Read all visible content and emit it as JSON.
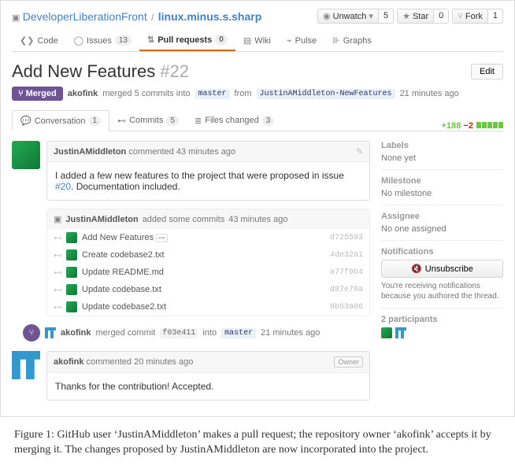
{
  "breadcrumb": {
    "owner": "DeveloperLiberationFront",
    "repo": "linux.minus.s.sharp"
  },
  "repo_actions": {
    "unwatch": "Unwatch",
    "unwatch_count": "5",
    "star": "Star",
    "star_count": "0",
    "fork": "Fork",
    "fork_count": "1"
  },
  "nav": {
    "code": "Code",
    "issues": "Issues",
    "issues_count": "13",
    "pulls": "Pull requests",
    "pulls_count": "0",
    "wiki": "Wiki",
    "pulse": "Pulse",
    "graphs": "Graphs"
  },
  "pr": {
    "title": "Add New Features",
    "number": "#22",
    "edit": "Edit",
    "state": "Merged",
    "merger": "akofink",
    "merge_summary_a": "merged 5 commits into",
    "base_branch": "master",
    "merge_summary_b": "from",
    "head_branch": "JustinAMiddleton-NewFeatures",
    "merge_when": "21 minutes ago"
  },
  "subtabs": {
    "conversation": "Conversation",
    "conversation_count": "1",
    "commits": "Commits",
    "commits_count": "5",
    "files": "Files changed",
    "files_count": "3",
    "additions": "+188",
    "deletions": "−2"
  },
  "comment1": {
    "user": "JustinAMiddleton",
    "action": "commented",
    "when": "43 minutes ago",
    "body_a": "I added a few new features to the project that were proposed in issue ",
    "issue_ref": "#20",
    "body_b": ". Documentation included."
  },
  "commits_block": {
    "user": "JustinAMiddleton",
    "action": "added some commits",
    "when": "43 minutes ago",
    "rows": [
      {
        "msg": "Add New Features",
        "ellipsis": true,
        "sha": "d725593"
      },
      {
        "msg": "Create codebase2.txt",
        "ellipsis": false,
        "sha": "4de32a1"
      },
      {
        "msg": "Update README.md",
        "ellipsis": false,
        "sha": "a77f9b4"
      },
      {
        "msg": "Update codebase.txt",
        "ellipsis": false,
        "sha": "d87e70a"
      },
      {
        "msg": "Update codebase2.txt",
        "ellipsis": false,
        "sha": "9b63a06"
      }
    ]
  },
  "merge_event": {
    "user": "akofink",
    "text_a": "merged commit",
    "sha": "f03e411",
    "text_b": "into",
    "branch": "master",
    "when": "21 minutes ago"
  },
  "comment2": {
    "user": "akofink",
    "action": "commented",
    "when": "20 minutes ago",
    "owner_tag": "Owner",
    "body": "Thanks for the contribution! Accepted."
  },
  "sidebar": {
    "labels_title": "Labels",
    "labels_value": "None yet",
    "milestone_title": "Milestone",
    "milestone_value": "No milestone",
    "assignee_title": "Assignee",
    "assignee_value": "No one assigned",
    "notifications_title": "Notifications",
    "unsubscribe": "Unsubscribe",
    "notif_desc": "You're receiving notifications because you authored the thread.",
    "participants_title": "2 participants"
  },
  "caption": "Figure 1: GitHub user ‘JustinAMiddleton’ makes a pull request; the repository owner ‘akofink’ accepts it by merging it. The changes proposed by JustinAMiddleton are now incorporated into the project."
}
